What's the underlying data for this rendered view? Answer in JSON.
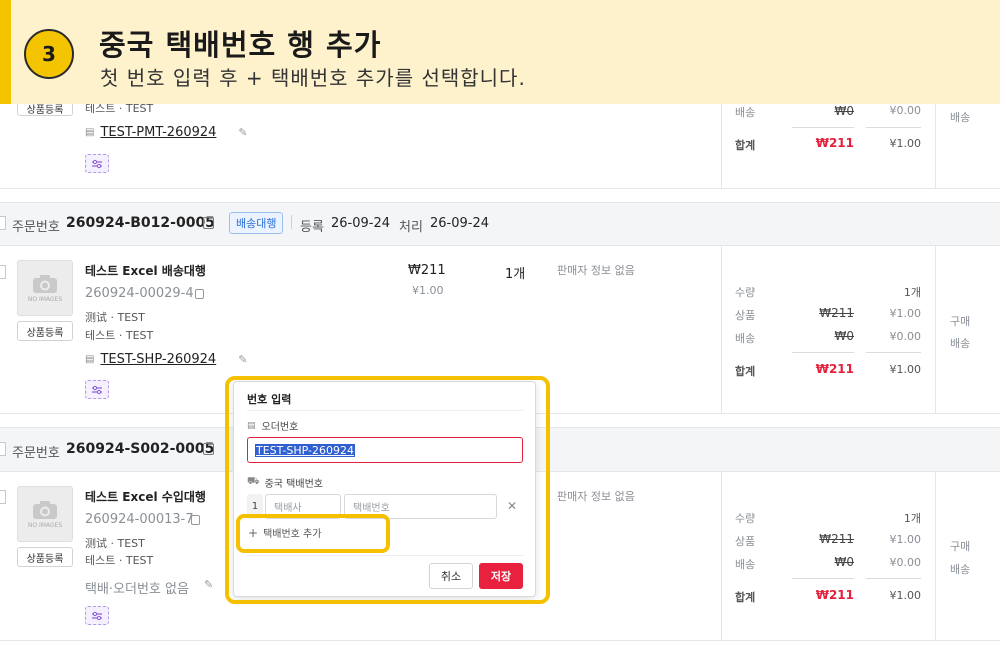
{
  "banner": {
    "step": "3",
    "title": "중국 택배번호 행 추가",
    "subtitle": "첫 번호 입력 후 + 택배번호 추가를 선택합니다."
  },
  "labels": {
    "register_btn": "상품등록",
    "no_image": "NO IMAGES",
    "order_no_prefix": "주문번호",
    "registered": "등록",
    "processed": "처리",
    "no_seller_info": "판매자 정보 없음"
  },
  "summary_labels": {
    "qty": "수량",
    "product": "상품",
    "shipping": "배송",
    "total": "합계"
  },
  "order_top": {
    "seller_line": "테스트 · TEST",
    "tracking": "TEST-PMT-260924",
    "summary": {
      "shipping_krw": "₩0",
      "shipping_cny": "¥0.00",
      "total_krw": "₩211",
      "total_cny": "¥1.00"
    },
    "right_label": "배송"
  },
  "order_1": {
    "order_no": "260924-B012-0005",
    "tag": "배송대행",
    "registered_date": "26-09-24",
    "processed_date": "26-09-24",
    "product_name": "테스트 Excel 배송대행",
    "product_code": "260924-00029-4",
    "sub_line": "测试 · TEST",
    "seller_line": "테스트 · TEST",
    "tracking": "TEST-SHP-260924",
    "price_krw": "₩211",
    "price_cny": "¥1.00",
    "qty": "1개",
    "summary": {
      "qty": "1개",
      "product_krw": "₩211",
      "product_cny": "¥1.00",
      "shipping_krw": "₩0",
      "shipping_cny": "¥0.00",
      "total_krw": "₩211",
      "total_cny": "¥1.00"
    },
    "right_labels": [
      "구매",
      "배송"
    ]
  },
  "order_2": {
    "order_no": "260924-S002-0005",
    "product_name": "테스트 Excel 수입대행",
    "product_code": "260924-00013-7",
    "sub_line": "测试 · TEST",
    "seller_line": "테스트 · TEST",
    "no_tracking": "택배·오더번호 없음",
    "summary": {
      "qty": "1개",
      "product_krw": "₩211",
      "product_cny": "¥1.00",
      "shipping_krw": "₩0",
      "shipping_cny": "¥0.00",
      "total_krw": "₩211",
      "total_cny": "¥1.00"
    },
    "right_labels": [
      "구매",
      "배송"
    ]
  },
  "modal": {
    "title": "번호 입력",
    "order_label": "오더번호",
    "order_value": "TEST-SHP-260924",
    "tracking_label": "중국 택배번호",
    "row_index": "1",
    "carrier_placeholder": "택배사",
    "tracking_placeholder": "택배번호",
    "add_label": "택배번호 추가",
    "cancel": "취소",
    "save": "저장"
  },
  "colors": {
    "accent_red": "#e4213d",
    "highlight_yellow": "#f5c000",
    "banner_bg": "#fdf2cc"
  }
}
